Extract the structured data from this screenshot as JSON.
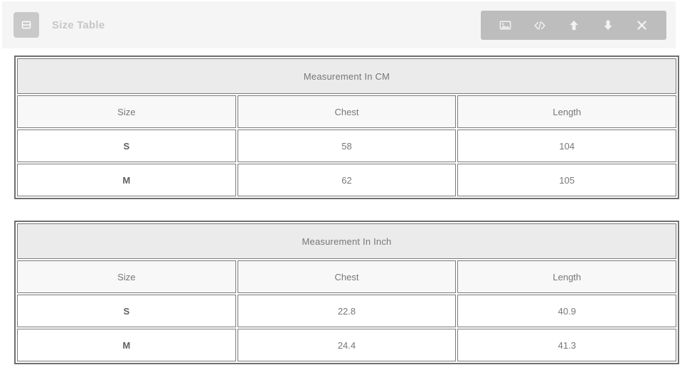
{
  "toolbar": {
    "handle_icon": "table-block-icon",
    "title": "Size Table",
    "actions": [
      {
        "name": "insert-image-button",
        "icon": "image-icon",
        "label": "Image"
      },
      {
        "name": "edit-code-button",
        "icon": "code-icon",
        "label": "</>"
      },
      {
        "name": "move-up-button",
        "icon": "arrow-up-icon",
        "label": "Move Up"
      },
      {
        "name": "move-down-button",
        "icon": "arrow-down-icon",
        "label": "Move Down"
      },
      {
        "name": "close-button",
        "icon": "close-icon",
        "label": "Close"
      }
    ]
  },
  "colors": {
    "toolbar_bg": "#f5f5f5",
    "handle_bg": "#c9c9c9",
    "actions_bg": "#bdbdbd",
    "title_text": "#c7c7c7",
    "caption_bg": "#ebebeb",
    "head_bg": "#f8f8f8",
    "border_outer": "#6f6f6f",
    "border_cell": "#7a7a7a",
    "text": "#7a7a7a"
  },
  "tables": [
    {
      "caption": "Measurement In CM",
      "columns": [
        "Size",
        "Chest",
        "Length"
      ],
      "rows": [
        [
          "S",
          "58",
          "104"
        ],
        [
          "M",
          "62",
          "105"
        ]
      ]
    },
    {
      "caption": "Measurement In Inch",
      "columns": [
        "Size",
        "Chest",
        "Length"
      ],
      "rows": [
        [
          "S",
          "22.8",
          "40.9"
        ],
        [
          "M",
          "24.4",
          "41.3"
        ]
      ]
    }
  ]
}
